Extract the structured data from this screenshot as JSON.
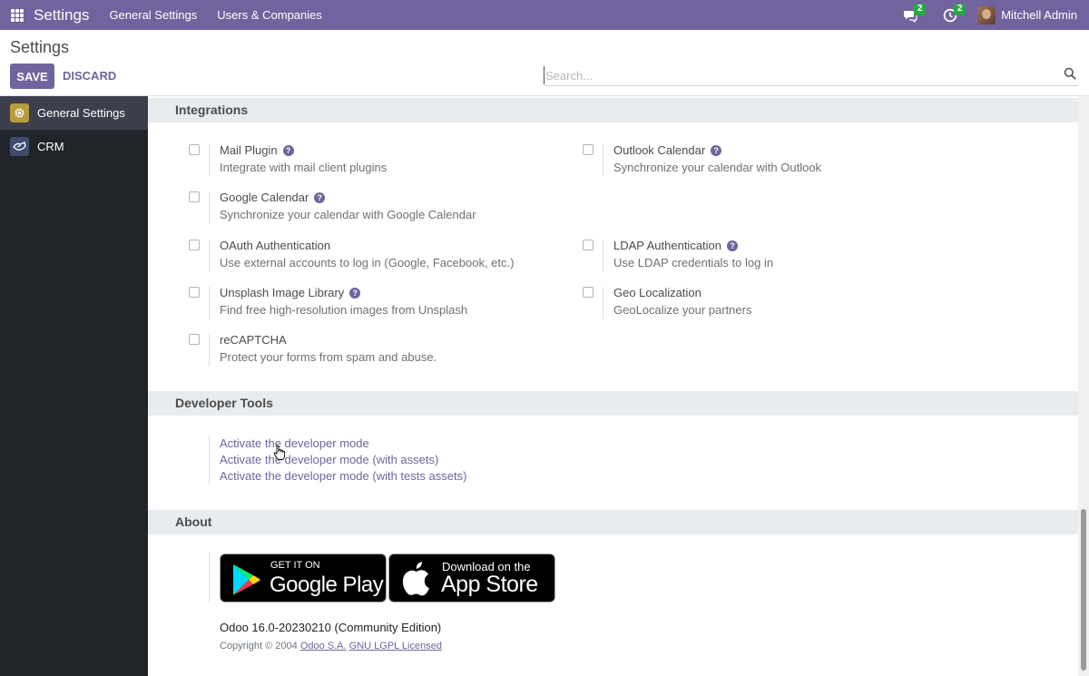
{
  "navbar": {
    "app_title": "Settings",
    "menus": [
      "General Settings",
      "Users & Companies"
    ],
    "messages_count": "2",
    "activities_count": "2",
    "user_name": "Mitchell Admin",
    "bg_color": "#71639e"
  },
  "control_panel": {
    "title": "Settings",
    "save_label": "SAVE",
    "discard_label": "DISCARD",
    "search_placeholder": "Search..."
  },
  "sidebar": {
    "items": [
      {
        "label": "General Settings",
        "icon": "gear-icon",
        "active": true
      },
      {
        "label": "CRM",
        "icon": "crm-icon",
        "active": false
      }
    ]
  },
  "sections": {
    "integrations": {
      "title": "Integrations",
      "settings": [
        {
          "title": "Mail Plugin",
          "desc": "Integrate with mail client plugins",
          "help": true
        },
        {
          "title": "Outlook Calendar",
          "desc": "Synchronize your calendar with Outlook",
          "help": true
        },
        {
          "title": "Google Calendar",
          "desc": "Synchronize your calendar with Google Calendar",
          "help": true
        },
        {
          "title": "OAuth Authentication",
          "desc": "Use external accounts to log in (Google, Facebook, etc.)",
          "help": false
        },
        {
          "title": "LDAP Authentication",
          "desc": "Use LDAP credentials to log in",
          "help": true
        },
        {
          "title": "Unsplash Image Library",
          "desc": "Find free high-resolution images from Unsplash",
          "help": true
        },
        {
          "title": "Geo Localization",
          "desc": "GeoLocalize your partners",
          "help": false
        },
        {
          "title": "reCAPTCHA",
          "desc": "Protect your forms from spam and abuse.",
          "help": false
        }
      ]
    },
    "developer_tools": {
      "title": "Developer Tools",
      "links": [
        "Activate the developer mode",
        "Activate the developer mode (with assets)",
        "Activate the developer mode (with tests assets)"
      ]
    },
    "about": {
      "title": "About",
      "google_play": {
        "small": "GET IT ON",
        "big": "Google Play"
      },
      "app_store": {
        "small": "Download on the",
        "big": "App Store"
      },
      "version": "Odoo 16.0-20230210 (Community Edition)",
      "copyright_prefix": "Copyright © 2004",
      "company_link": "Odoo S.A.",
      "license_link": "GNU LGPL Licensed"
    }
  },
  "help_glyph": "?"
}
